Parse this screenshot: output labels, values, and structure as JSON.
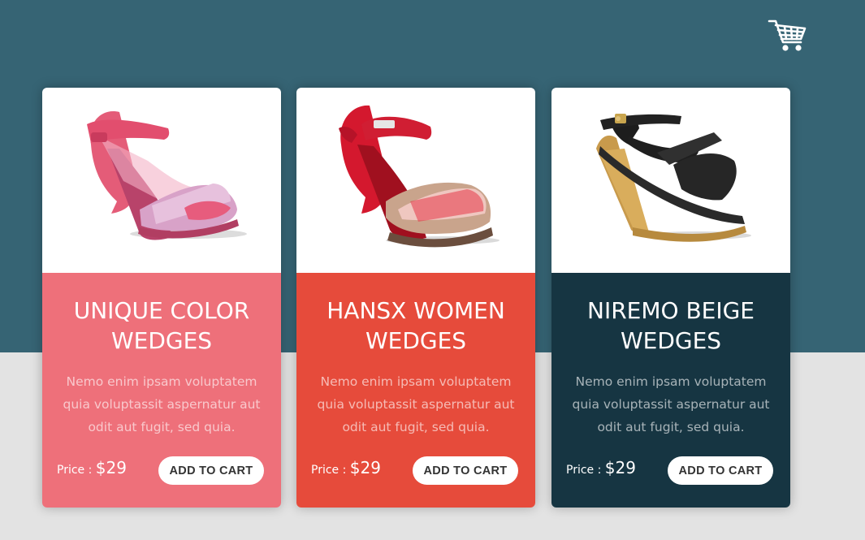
{
  "header": {
    "cart_icon": "shopping-cart-icon"
  },
  "colors": {
    "header_bg": "#366474",
    "page_bg": "#e3e3e3",
    "card1_accent": "#ee707a",
    "card2_accent": "#e64b3b",
    "card3_accent": "#163542"
  },
  "cards": [
    {
      "title_line1": "UNIQUE COLOR",
      "title_line2": "WEDGES",
      "description": "Nemo enim ipsam voluptatem quia voluptassit aspernatur aut odit aut fugit, sed quia.",
      "price_label": "Price : ",
      "price": "$29",
      "button": "ADD TO CART",
      "image": "pink-wedge-sandal"
    },
    {
      "title_line1": "HANSX WOMEN",
      "title_line2": "WEDGES",
      "description": "Nemo enim ipsam voluptatem quia voluptassit aspernatur aut odit aut fugit, sed quia.",
      "price_label": "Price : ",
      "price": "$29",
      "button": "ADD TO CART",
      "image": "red-wedge-sandal"
    },
    {
      "title_line1": "NIREMO BEIGE",
      "title_line2": "WEDGES",
      "description": "Nemo enim ipsam voluptatem quia voluptassit aspernatur aut odit aut fugit, sed quia.",
      "price_label": "Price : ",
      "price": "$29",
      "button": "ADD TO CART",
      "image": "black-cork-wedge-sandal"
    }
  ]
}
